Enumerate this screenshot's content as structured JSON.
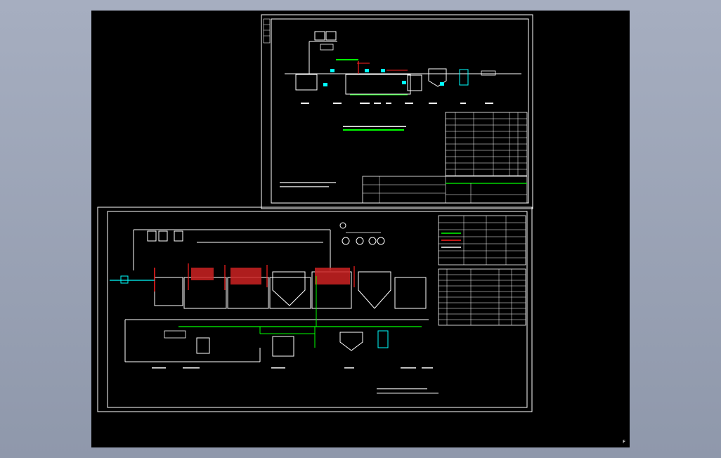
{
  "viewer": {
    "background": "#000000",
    "desktop_color": "#9aa3b5",
    "corner_mark": "F"
  },
  "colors": {
    "frame": "#ffffff",
    "pipe_main": "#ffffff",
    "pipe_return": "#00ff00",
    "pipe_hot": "#ff2020",
    "equipment": "#00ffff",
    "fill_red": "#cc2222"
  }
}
